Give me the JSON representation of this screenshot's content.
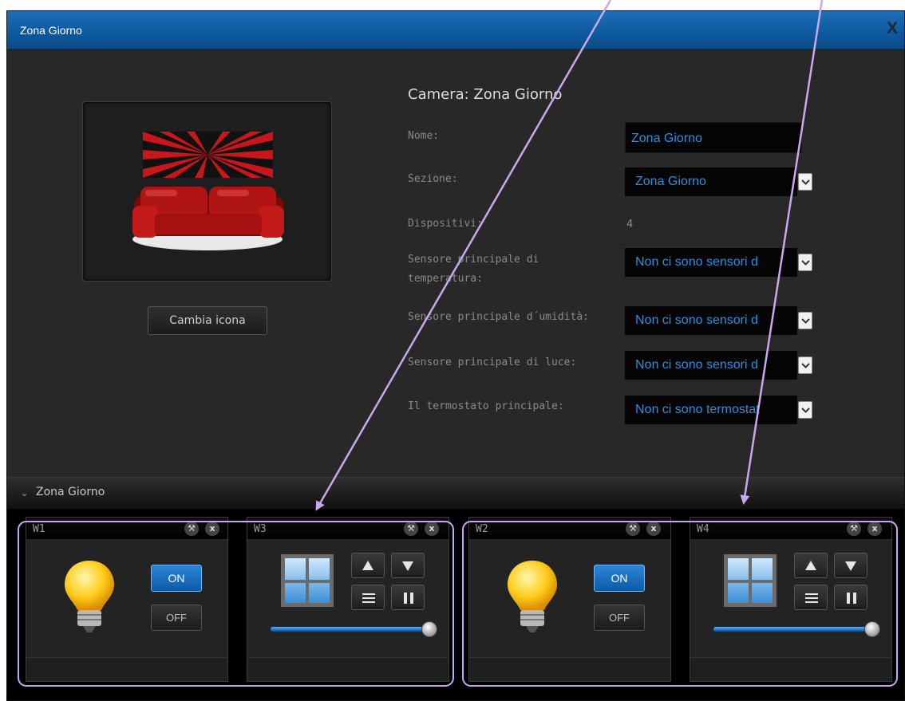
{
  "window": {
    "title": "Zona Giorno",
    "close_label": "X"
  },
  "room_icon": {
    "icon": "sofa-room-icon"
  },
  "change_icon_button": "Cambia icona",
  "room": {
    "heading": "Camera: Zona Giorno",
    "fields": {
      "nome": {
        "label": "Nome:",
        "value": "Zona Giorno"
      },
      "sezione": {
        "label": "Sezione:",
        "value": "Zona Giorno"
      },
      "dispositivi": {
        "label": "Dispositivi:",
        "value": "4"
      },
      "temperatura": {
        "label_line1": "Sensore principale di",
        "label_line2": "temperatura:",
        "value": "Non ci sono sensori d"
      },
      "umidita": {
        "label": "Sensore principale d´umidità:",
        "value": "Non ci sono sensori d"
      },
      "luce": {
        "label": "Sensore principale di luce:",
        "value": "Non ci sono sensori d"
      },
      "termostato": {
        "label": "Il termostato principale:",
        "value": "Non ci sono termostat"
      }
    }
  },
  "group": {
    "name": "Zona Giorno",
    "expanded": true
  },
  "widgets": [
    {
      "title": "W1",
      "type": "light",
      "on_label": "ON",
      "off_label": "OFF",
      "state": "on",
      "settings_icon": "wrench-icon",
      "close_label": "x"
    },
    {
      "title": "W3",
      "type": "shutter",
      "level_percent": 100,
      "settings_icon": "wrench-icon",
      "close_label": "x"
    },
    {
      "title": "W2",
      "type": "light",
      "on_label": "ON",
      "off_label": "OFF",
      "state": "on",
      "settings_icon": "wrench-icon",
      "close_label": "x"
    },
    {
      "title": "W4",
      "type": "shutter",
      "level_percent": 100,
      "settings_icon": "wrench-icon",
      "close_label": "x"
    }
  ],
  "colors": {
    "titlebar": "#1466ad",
    "value_blue": "#2d8de0",
    "annotation": "#c9a8ec",
    "on_button": "#1a6fc4"
  }
}
